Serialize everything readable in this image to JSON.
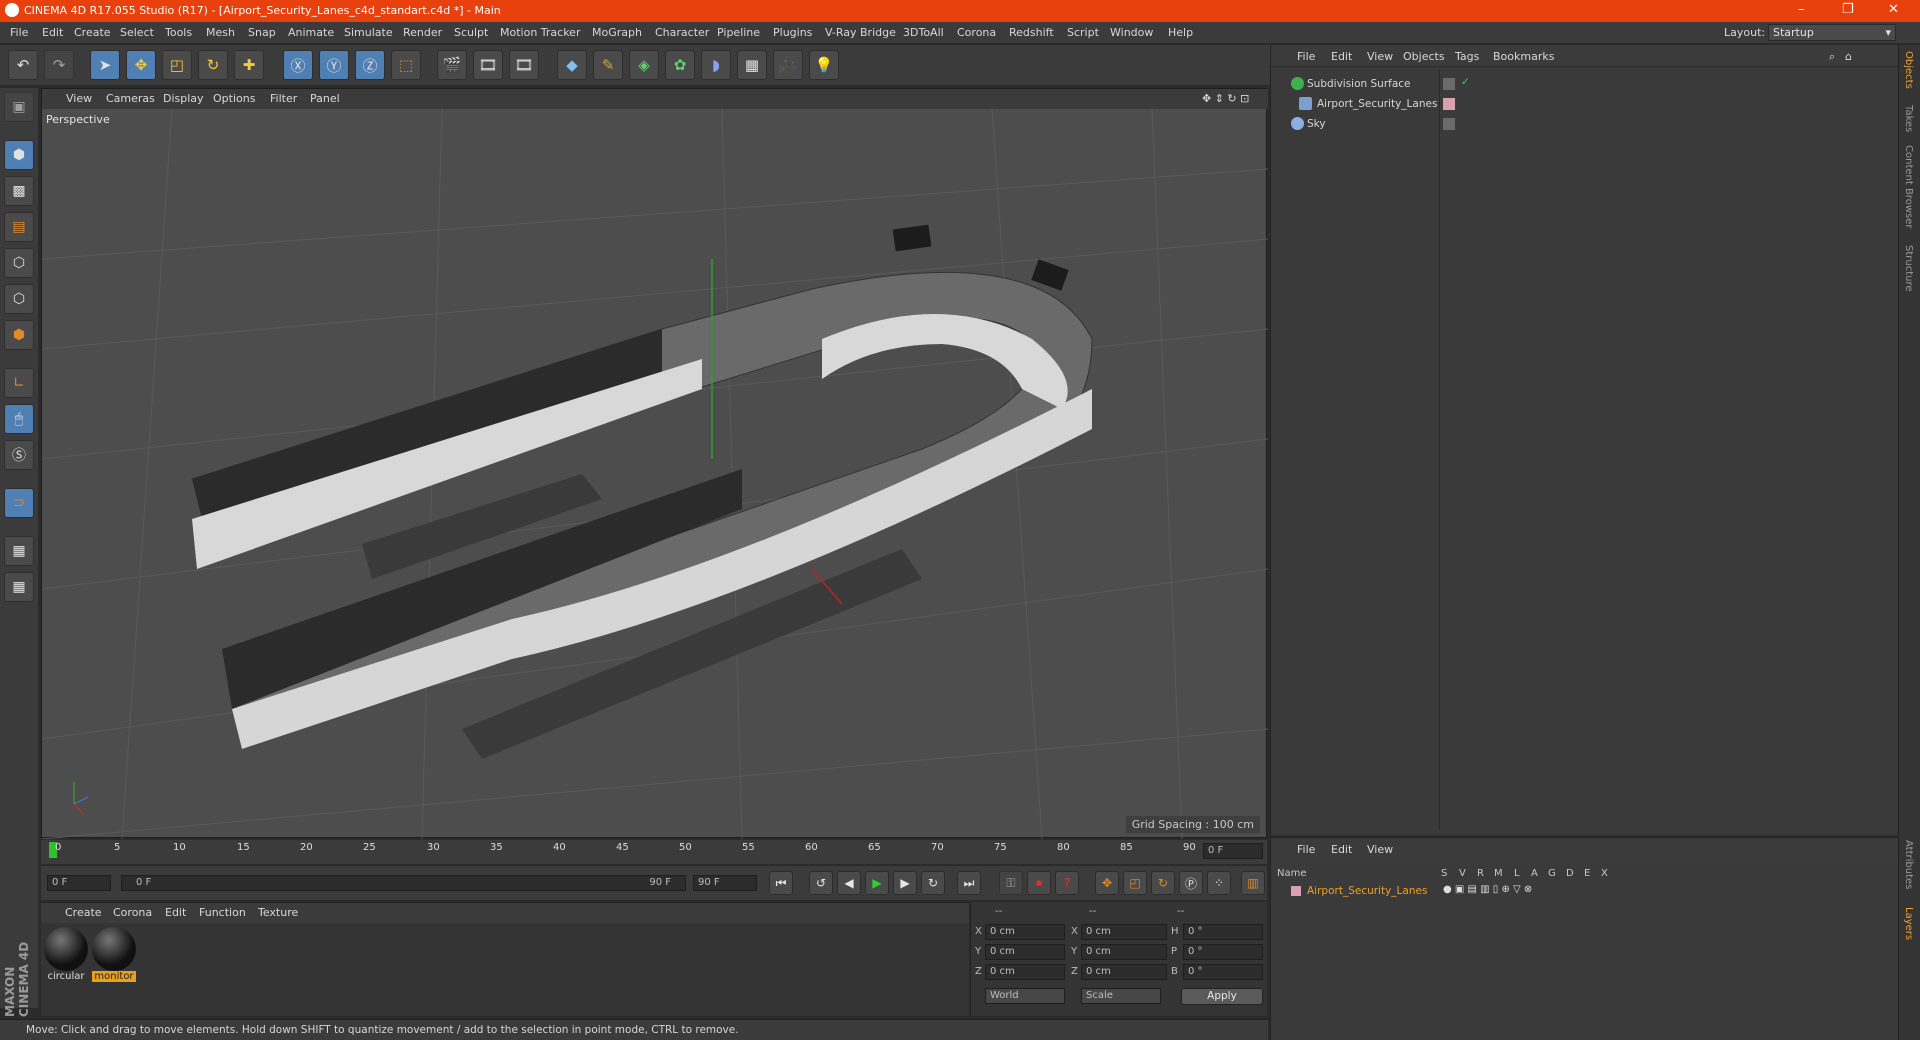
{
  "window": {
    "title": "CINEMA 4D R17.055 Studio (R17) - [Airport_Security_Lanes_c4d_standart.c4d *] - Main",
    "min": "–",
    "max": "❐",
    "close": "✕"
  },
  "menu": [
    "File",
    "Edit",
    "Create",
    "Select",
    "Tools",
    "Mesh",
    "Snap",
    "Animate",
    "Simulate",
    "Render",
    "Sculpt",
    "Motion Tracker",
    "MoGraph",
    "Character",
    "Pipeline",
    "Plugins",
    "V-Ray Bridge",
    "3DToAll",
    "Corona",
    "Redshift",
    "Script",
    "Window",
    "Help"
  ],
  "layout": {
    "label": "Layout:",
    "value": "Startup"
  },
  "viewport": {
    "menu": [
      "View",
      "Cameras",
      "Display",
      "Options",
      "Filter",
      "Panel"
    ],
    "label": "Perspective",
    "grid": "Grid Spacing : 100 cm"
  },
  "timeline": {
    "ticks": [
      "0",
      "5",
      "10",
      "15",
      "20",
      "25",
      "30",
      "35",
      "40",
      "45",
      "50",
      "55",
      "60",
      "65",
      "70",
      "75",
      "80",
      "85",
      "90"
    ],
    "frame_right": "0 F"
  },
  "transport": {
    "start": "0 F",
    "range_start": "0 F",
    "range_end": "90 F",
    "end": "90 F"
  },
  "materials": {
    "menu": [
      "Create",
      "Corona",
      "Edit",
      "Function",
      "Texture"
    ],
    "items": [
      "circular",
      "monitor"
    ]
  },
  "coords": {
    "header": [
      "--",
      "--",
      "--"
    ],
    "rows": [
      {
        "a": "X",
        "v1": "0 cm",
        "b": "X",
        "v2": "0 cm",
        "c": "H",
        "v3": "0 °"
      },
      {
        "a": "Y",
        "v1": "0 cm",
        "b": "Y",
        "v2": "0 cm",
        "c": "P",
        "v3": "0 °"
      },
      {
        "a": "Z",
        "v1": "0 cm",
        "b": "Z",
        "v2": "0 cm",
        "c": "B",
        "v3": "0 °"
      }
    ],
    "world": "World",
    "scale": "Scale",
    "apply": "Apply"
  },
  "status": "Move: Click and drag to move elements. Hold down SHIFT to quantize movement / add to the selection in point mode, CTRL to remove.",
  "objects": {
    "menu": [
      "File",
      "Edit",
      "View",
      "Objects",
      "Tags",
      "Bookmarks"
    ],
    "items": [
      "Subdivision Surface",
      "Airport_Security_Lanes",
      "Sky"
    ]
  },
  "layers": {
    "menu": [
      "File",
      "Edit",
      "View"
    ],
    "name_header": "Name",
    "cols": [
      "S",
      "V",
      "R",
      "M",
      "L",
      "A",
      "G",
      "D",
      "E",
      "X"
    ],
    "item": "Airport_Security_Lanes"
  },
  "sidetabs": [
    "Objects",
    "Takes",
    "Content Browser",
    "Structure",
    "Attributes",
    "Layers"
  ],
  "brand": "MAXON CINEMA 4D"
}
